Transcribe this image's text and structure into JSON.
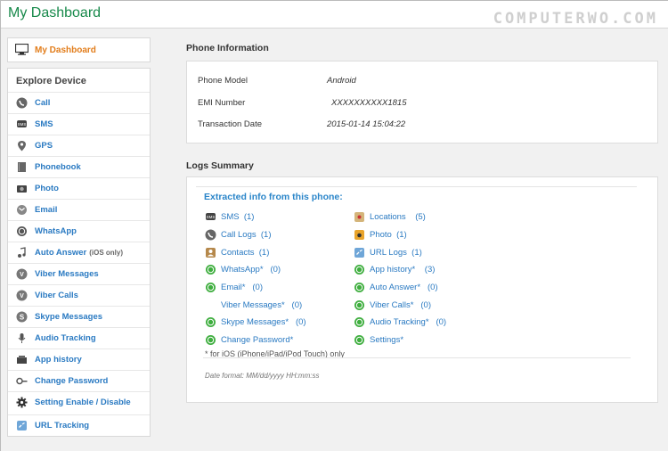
{
  "header": {
    "title": "My Dashboard",
    "watermark": "COMPUTERWO.COM"
  },
  "sidebar": {
    "dashboard_label": "My Dashboard",
    "section_title": "Explore Device",
    "items": [
      {
        "label": "Call",
        "sub": "",
        "icon": "phone-icon"
      },
      {
        "label": "SMS",
        "sub": "",
        "icon": "sms-icon"
      },
      {
        "label": "GPS",
        "sub": "",
        "icon": "map-pin-icon"
      },
      {
        "label": "Phonebook",
        "sub": "",
        "icon": "phonebook-icon"
      },
      {
        "label": "Photo",
        "sub": "",
        "icon": "camera-icon"
      },
      {
        "label": "Email",
        "sub": "",
        "icon": "email-icon"
      },
      {
        "label": "WhatsApp",
        "sub": "",
        "icon": "whatsapp-icon"
      },
      {
        "label": "Auto Answer",
        "sub": "(iOS only)",
        "icon": "music-note-icon"
      },
      {
        "label": "Viber Messages",
        "sub": "",
        "icon": "viber-icon"
      },
      {
        "label": "Viber Calls",
        "sub": "",
        "icon": "viber-icon"
      },
      {
        "label": "Skype Messages",
        "sub": "",
        "icon": "skype-icon"
      },
      {
        "label": "Audio Tracking",
        "sub": "",
        "icon": "microphone-icon"
      },
      {
        "label": "App history",
        "sub": "",
        "icon": "app-history-icon"
      },
      {
        "label": "Change Password",
        "sub": "",
        "icon": "key-icon"
      },
      {
        "label": "Setting Enable / Disable",
        "sub": "",
        "icon": "gear-icon"
      },
      {
        "label": "URL Tracking",
        "sub": "",
        "icon": "url-icon"
      }
    ]
  },
  "phone_info": {
    "title": "Phone Information",
    "rows": [
      {
        "label": "Phone Model",
        "value": "Android"
      },
      {
        "label": "EMI Number",
        "value": "XXXXXXXXXX1815"
      },
      {
        "label": "Transaction Date",
        "value": "2015-01-14 15:04:22"
      }
    ]
  },
  "logs": {
    "title": "Logs Summary",
    "subtitle": "Extracted info from this phone:",
    "left": [
      {
        "label": "SMS  (1)",
        "icon": "sms-icon",
        "color": "#f3b23a"
      },
      {
        "label": "Call Logs  (1)",
        "icon": "phone-icon",
        "color": "#3aa63a"
      },
      {
        "label": "Contacts  (1)",
        "icon": "contacts-icon",
        "color": "#b5884b"
      },
      {
        "label": "WhatsApp*   (0)",
        "icon": "whatsapp-icon",
        "color": "#3fae3f"
      },
      {
        "label": "Email*   (0)",
        "icon": "whatsapp-icon",
        "color": "#3fae3f"
      },
      {
        "label": "Viber Messages*   (0)",
        "icon": "",
        "color": ""
      },
      {
        "label": "Skype Messages*   (0)",
        "icon": "whatsapp-icon",
        "color": "#3fae3f"
      },
      {
        "label": "Change Password*",
        "icon": "whatsapp-icon",
        "color": "#3fae3f"
      }
    ],
    "right": [
      {
        "label": "Locations    (5)",
        "icon": "locations-icon",
        "color": "#d4b57a"
      },
      {
        "label": "Photo  (1)",
        "icon": "photo-icon",
        "color": "#e9a42b"
      },
      {
        "label": "URL Logs  (1)",
        "icon": "url-icon",
        "color": "#6fa6d8"
      },
      {
        "label": "App history*    (3)",
        "icon": "whatsapp-icon",
        "color": "#3fae3f"
      },
      {
        "label": "Auto Answer*   (0)",
        "icon": "whatsapp-icon",
        "color": "#3fae3f"
      },
      {
        "label": "Viber Calls*   (0)",
        "icon": "whatsapp-icon",
        "color": "#3fae3f"
      },
      {
        "label": "Audio Tracking*   (0)",
        "icon": "whatsapp-icon",
        "color": "#3fae3f"
      },
      {
        "label": "Settings*",
        "icon": "whatsapp-icon",
        "color": "#3fae3f"
      }
    ],
    "note": "* for iOS (iPhone/iPad/iPod Touch) only",
    "date_format": "Date format: MM/dd/yyyy HH:mm:ss"
  }
}
